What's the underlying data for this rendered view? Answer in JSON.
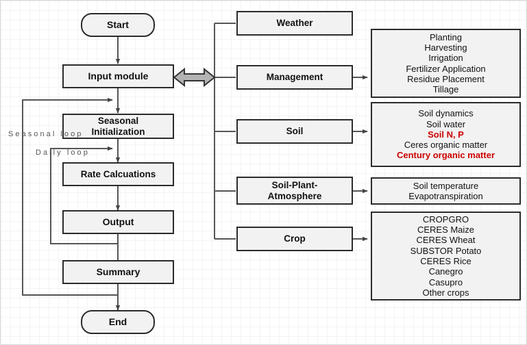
{
  "diagram": {
    "title": "DSSAT Cropping System Model flow diagram",
    "colors": {
      "node_fill": "#f2f2f2",
      "node_border": "#2b2b2b",
      "highlight_text": "#cc0000",
      "wire": "#555555",
      "grid": "#e9e9e9"
    }
  },
  "main_flow": {
    "nodes": [
      {
        "id": "start",
        "label": "Start",
        "shape": "rounded"
      },
      {
        "id": "input_module",
        "label": "Input module",
        "shape": "rect"
      },
      {
        "id": "seasonal_initialization",
        "label": "Seasonal\nInitialization",
        "shape": "rect"
      },
      {
        "id": "rate_calculations",
        "label": "Rate Calcuations",
        "shape": "rect"
      },
      {
        "id": "output",
        "label": "Output",
        "shape": "rect"
      },
      {
        "id": "summary",
        "label": "Summary",
        "shape": "rect"
      },
      {
        "id": "end",
        "label": "End",
        "shape": "rounded"
      }
    ]
  },
  "loops": {
    "seasonal": "S e a s o n a l   l o o p",
    "daily": "D a i l y   l o o p"
  },
  "modules": [
    {
      "id": "weather",
      "label": "Weather"
    },
    {
      "id": "management",
      "label": "Management"
    },
    {
      "id": "soil",
      "label": "Soil"
    },
    {
      "id": "soil_plant_atmosphere",
      "label": "Soil-Plant-\nAtmosphere"
    },
    {
      "id": "crop",
      "label": "Crop"
    }
  ],
  "details": {
    "management": [
      {
        "text": "Planting",
        "highlight": false
      },
      {
        "text": "Harvesting",
        "highlight": false
      },
      {
        "text": "Irrigation",
        "highlight": false
      },
      {
        "text": "Fertilizer Application",
        "highlight": false
      },
      {
        "text": "Residue Placement",
        "highlight": false
      },
      {
        "text": "Tillage",
        "highlight": false
      }
    ],
    "soil": [
      {
        "text": "Soil dynamics",
        "highlight": false
      },
      {
        "text": "Soil water",
        "highlight": false
      },
      {
        "text": "Soil N, P",
        "highlight": true
      },
      {
        "text": "Ceres organic matter",
        "highlight": false
      },
      {
        "text": "Century organic matter",
        "highlight": true
      }
    ],
    "soil_plant_atmosphere": [
      {
        "text": "Soil temperature",
        "highlight": false
      },
      {
        "text": "Evapotranspiration",
        "highlight": false
      }
    ],
    "crop": [
      {
        "text": "CROPGRO",
        "highlight": false
      },
      {
        "text": "CERES Maize",
        "highlight": false
      },
      {
        "text": "CERES Wheat",
        "highlight": false
      },
      {
        "text": "SUBSTOR Potato",
        "highlight": false
      },
      {
        "text": "CERES Rice",
        "highlight": false
      },
      {
        "text": "Canegro",
        "highlight": false
      },
      {
        "text": "Casupro",
        "highlight": false
      },
      {
        "text": "Other crops",
        "highlight": false
      }
    ]
  }
}
